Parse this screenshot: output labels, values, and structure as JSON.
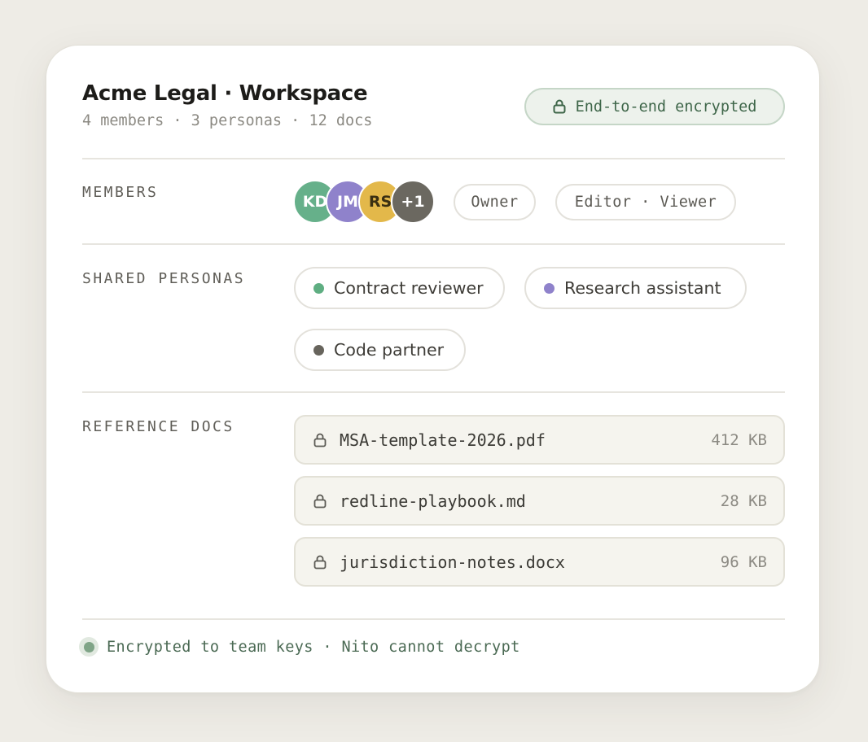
{
  "header": {
    "title": "Acme Legal · Workspace",
    "subtitle": "4 members · 3 personas · 12 docs",
    "encryption_badge": {
      "label": "End-to-end encrypted",
      "icon": "lock-icon"
    }
  },
  "members": {
    "label": "MEMBERS",
    "avatars": [
      {
        "initials": "KD",
        "color": "#66b08a"
      },
      {
        "initials": "JM",
        "color": "#8f82cb"
      },
      {
        "initials": "RS",
        "color": "#e3b84a"
      },
      {
        "initials": "+1",
        "color": "#6b6860"
      }
    ],
    "roles": [
      "Owner",
      "Editor · Viewer"
    ]
  },
  "personas": {
    "label": "SHARED PERSONAS",
    "items": [
      {
        "name": "Contract reviewer",
        "color": "#5fae82"
      },
      {
        "name": "Research assistant",
        "color": "#8f82cb"
      },
      {
        "name": "Code partner",
        "color": "#67645c"
      }
    ]
  },
  "docs": {
    "label": "REFERENCE DOCS",
    "items": [
      {
        "name": "MSA-template-2026.pdf",
        "size": "412 KB",
        "icon": "lock-icon"
      },
      {
        "name": "redline-playbook.md",
        "size": "28 KB",
        "icon": "lock-icon"
      },
      {
        "name": "jurisdiction-notes.docx",
        "size": "96 KB",
        "icon": "lock-icon"
      }
    ]
  },
  "footer": {
    "text": "Encrypted to team keys · Nito cannot decrypt",
    "status_color": "#7fa487"
  }
}
